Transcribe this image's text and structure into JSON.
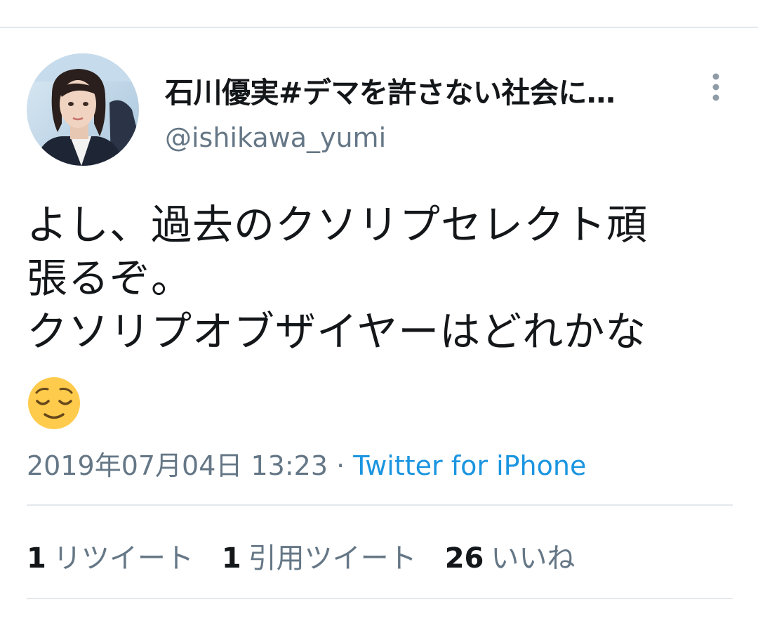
{
  "tweet": {
    "display_name": "石川優実#デマを許さない社会に…",
    "handle": "@ishikawa_yumi",
    "text": "よし、過去のクソリプセレクト頑\n張るぞ。\nクソリプオブザイヤーはどれかな",
    "emoji": "relieved-face",
    "timestamp": "2019年07月04日 13:23",
    "separator": "·",
    "source": "Twitter for iPhone"
  },
  "stats": [
    {
      "count": "1",
      "label": "リツイート"
    },
    {
      "count": "1",
      "label": "引用ツイート"
    },
    {
      "count": "26",
      "label": "いいね"
    }
  ],
  "icons": {
    "more": "vertical-ellipsis-icon"
  },
  "colors": {
    "text": "#14171a",
    "secondary": "#657786",
    "link": "#1b95e0",
    "divider": "#e3e8ec"
  }
}
